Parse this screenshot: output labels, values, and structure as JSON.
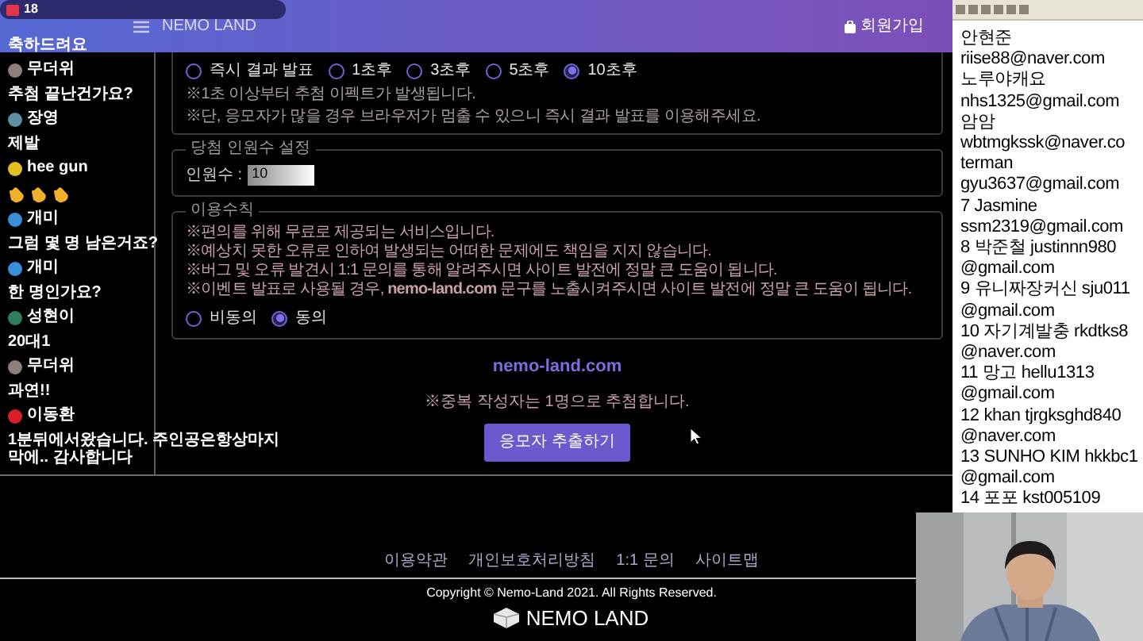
{
  "stream_overlay": {
    "viewer_count": "18"
  },
  "chat": {
    "messages": [
      {
        "kind": "text",
        "text": "축하드려요"
      },
      {
        "kind": "user",
        "name": "무더위",
        "color": "#8a7f7a"
      },
      {
        "kind": "text",
        "text": "추첨 끝난건가요?"
      },
      {
        "kind": "user",
        "name": "장영",
        "color": "#5f8fa0"
      },
      {
        "kind": "text",
        "text": "제발"
      },
      {
        "kind": "user",
        "name": "hee gun",
        "color": "#e0c020"
      },
      {
        "kind": "claps"
      },
      {
        "kind": "user",
        "name": "개미",
        "color": "#3a8fd8"
      },
      {
        "kind": "text",
        "text": "그럼 몇 명 남은거죠?"
      },
      {
        "kind": "user",
        "name": "개미",
        "color": "#3a8fd8"
      },
      {
        "kind": "text",
        "text": "한 명인가요?"
      },
      {
        "kind": "user",
        "name": "성현이",
        "color": "#2e7d5b"
      },
      {
        "kind": "text",
        "text": "20대1"
      },
      {
        "kind": "user",
        "name": "무더위",
        "color": "#8a7f7a"
      },
      {
        "kind": "text",
        "text": "과연!!"
      },
      {
        "kind": "user",
        "name": "이동환",
        "color": "#d81e2a"
      },
      {
        "kind": "text",
        "text": "1분뒤에서왔습니다. 주인공은항상마지막에.. 감사합니다"
      }
    ]
  },
  "header": {
    "logo": "NEMO LAND",
    "signup": "회원가입"
  },
  "timing": {
    "options": [
      {
        "label": "즉시 결과 발표",
        "selected": false
      },
      {
        "label": "1초후",
        "selected": false
      },
      {
        "label": "3초후",
        "selected": false
      },
      {
        "label": "5초후",
        "selected": false
      },
      {
        "label": "10초후",
        "selected": true
      }
    ],
    "notes": [
      "※1초 이상부터 추첨 이펙트가 발생됩니다.",
      "※단, 응모자가 많을 경우 브라우저가 멈출 수 있으니 즉시 결과 발표를 이용해주세요."
    ]
  },
  "winners": {
    "legend": "당첨 인원수 설정",
    "label": "인원수 :",
    "value": "10"
  },
  "rules": {
    "legend": "이용수칙",
    "lines": [
      "※편의를 위해 무료로 제공되는 서비스입니다.",
      "※예상치 못한 오류로 인하여 발생되는 어떠한 문제에도 책임을 지지 않습니다.",
      "※버그 및 오류 발견시 1:1 문의를 통해 알려주시면 사이트 발전에 정말 큰 도움이 됩니다.",
      "※이벤트 발표로 사용될 경우, **nemo-land.com** 문구를 노출시켜주시면 사이트 발전에 정말 큰 도움이 됩니다."
    ],
    "options": [
      {
        "label": "비동의",
        "selected": false
      },
      {
        "label": "동의",
        "selected": true
      }
    ]
  },
  "site_link": "nemo-land.com",
  "draw_note": "※중복 작성자는 1명으로 추첨합니다.",
  "draw_button": "응모자 추출하기",
  "footer": {
    "links": [
      "이용약관",
      "개인보호처리방침",
      "1:1 문의",
      "사이트맵"
    ],
    "copyright": "Copyright © Nemo-Land 2021. All Rights Reserved.",
    "logo": "NEMO LAND"
  },
  "notepad": {
    "lines": [
      "안현준",
      "riise88@naver.com",
      "노루야캐요",
      "nhs1325@gmail.com",
      "암암",
      "wbtmgkssk@naver.co",
      "terman",
      "gyu3637@gmail.com",
      "7 Jasmine",
      "ssm2319@gmail.com",
      "8 박준철 justinnn980",
      "@gmail.com",
      "9 유니짜장커신 sju011",
      "@gmail.com",
      "10 자기계발충 rkdtks8",
      "@naver.com",
      "11 망고 hellu1313",
      "@gmail.com",
      "12 khan tjrgksghd840",
      "@naver.com",
      "13 SUNHO KIM hkkbc1",
      "@gmail.com",
      "14 포포 kst005109"
    ]
  }
}
